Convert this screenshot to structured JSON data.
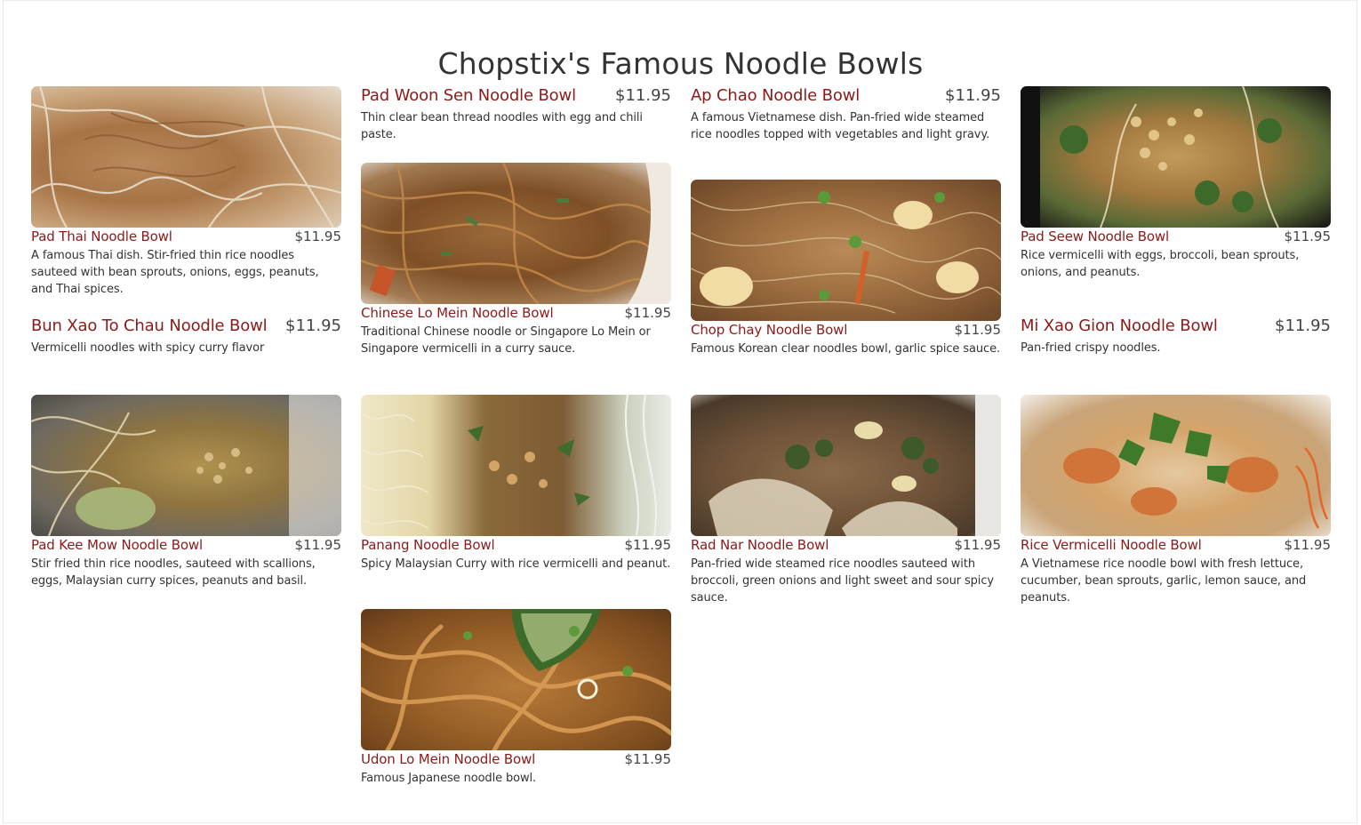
{
  "page": {
    "title": "Chopstix's Famous Noodle Bowls"
  },
  "theme": {
    "item_name_color": "#8b1a1a",
    "text_color": "#333333"
  },
  "items": [
    {
      "name": "Pad Thai Noodle Bowl",
      "price": "$11.95",
      "description": "A famous Thai dish. Stir-fried thin rice noodles sauteed with bean sprouts, onions, eggs, peanuts, and Thai spices.",
      "photo": "noodle-photo"
    },
    {
      "name": "Pad Woon Sen Noodle Bowl",
      "price": "$11.95",
      "description": "Thin clear bean thread noodles with egg and chili paste."
    },
    {
      "name": "Ap Chao Noodle Bowl",
      "price": "$11.95",
      "description": "A famous Vietnamese dish. Pan-fried wide steamed rice noodles topped with vegetables and light gravy."
    },
    {
      "name": "Pad Seew Noodle Bowl",
      "price": "$11.95",
      "description": "Rice vermicelli with eggs, broccoli, bean sprouts, onions, and peanuts.",
      "photo": "noodle-photo"
    },
    {
      "name": "Bun Xao To Chau Noodle Bowl",
      "price": "$11.95",
      "description": "Vermicelli noodles with spicy curry flavor"
    },
    {
      "name": "Chinese Lo Mein Noodle Bowl",
      "price": "$11.95",
      "description": "Traditional Chinese noodle or Singapore Lo Mein or Singapore vermicelli in a curry sauce.",
      "photo": "noodle-photo"
    },
    {
      "name": "Chop Chay Noodle Bowl",
      "price": "$11.95",
      "description": "Famous Korean clear noodles bowl, garlic spice sauce.",
      "photo": "noodle-photo"
    },
    {
      "name": "Mi Xao Gion Noodle Bowl",
      "price": "$11.95",
      "description": "Pan-fried crispy noodles."
    },
    {
      "name": "Pad Kee Mow Noodle Bowl",
      "price": "$11.95",
      "description": "Stir fried thin rice noodles, sauteed with scallions, eggs, Malaysian curry spices, peanuts and basil.",
      "photo": "noodle-photo"
    },
    {
      "name": "Panang Noodle Bowl",
      "price": "$11.95",
      "description": "Spicy Malaysian Curry with rice vermicelli and peanut.",
      "photo": "noodle-photo"
    },
    {
      "name": "Rad Nar Noodle Bowl",
      "price": "$11.95",
      "description": "Pan-fried wide steamed rice noodles sauteed with broccoli, green onions and light sweet and sour spicy sauce.",
      "photo": "noodle-photo"
    },
    {
      "name": "Rice Vermicelli Noodle Bowl",
      "price": "$11.95",
      "description": "A Vietnamese rice noodle bowl with fresh lettuce, cucumber, bean sprouts, garlic, lemon sauce, and peanuts.",
      "photo": "noodle-photo"
    },
    {
      "name": "Udon Lo Mein Noodle Bowl",
      "price": "$11.95",
      "description": "Famous Japanese noodle bowl.",
      "photo": "noodle-photo"
    }
  ]
}
